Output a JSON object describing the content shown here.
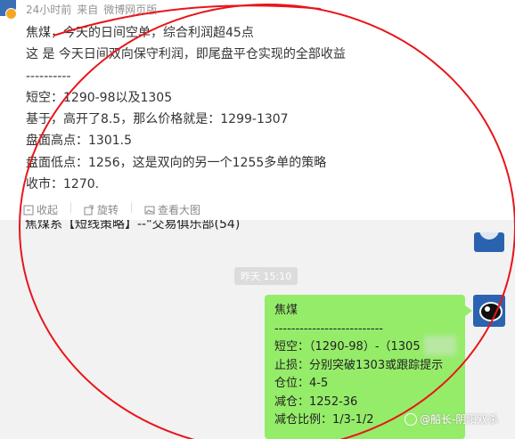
{
  "post": {
    "meta": {
      "time": "24小时前",
      "from": "来自",
      "client": "微博网页版"
    },
    "lines": [
      "焦煤，今天的日间空单，综合利润超45点",
      "这 是 今天日间双向保守利润，即尾盘平仓实现的全部收益",
      "----------",
      "短空：1290-98以及1305",
      "基于，高开了8.5，那么价格就是：1299-1307",
      "盘面高点：1301.5",
      "盘面低点：1256，这是双向的另一个1255多单的策略",
      "收市：1270."
    ],
    "actions": {
      "collect": "收起",
      "rotate": "旋转",
      "view_large": "查看大图"
    }
  },
  "chat": {
    "header_text": "焦煤系【短线策略】--\"交易俱乐部(54)",
    "timestamp": "昨天 15:10",
    "message_lines": [
      "焦煤",
      "--------------------------",
      "短空：（1290-98）-（1305",
      "止损：分别突破1303或跟踪提示",
      "仓位：4-5",
      "减仓：1252-36",
      "减仓比例：1/3-1/2"
    ],
    "watermark": "@船长-阴阳双杀"
  },
  "colors": {
    "bubble": "#95ec69",
    "annotation": "#e8161b",
    "meta": "#939393"
  }
}
